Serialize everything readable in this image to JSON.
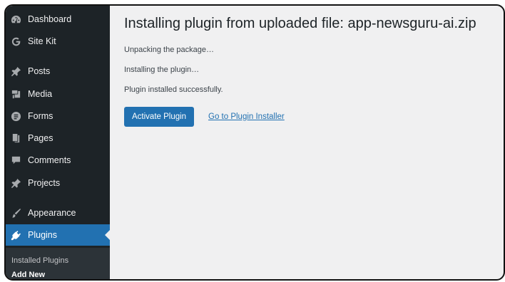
{
  "sidebar": {
    "items": [
      {
        "label": "Dashboard",
        "icon": "dashboard-icon"
      },
      {
        "label": "Site Kit",
        "icon": "google-g-icon"
      },
      {
        "label": "Posts",
        "icon": "pin-icon"
      },
      {
        "label": "Media",
        "icon": "media-icon"
      },
      {
        "label": "Forms",
        "icon": "forms-icon"
      },
      {
        "label": "Pages",
        "icon": "pages-icon"
      },
      {
        "label": "Comments",
        "icon": "comment-icon"
      },
      {
        "label": "Projects",
        "icon": "pin-icon"
      },
      {
        "label": "Appearance",
        "icon": "brush-icon"
      },
      {
        "label": "Plugins",
        "icon": "plug-icon",
        "active": true
      }
    ],
    "submenu": [
      {
        "label": "Installed Plugins"
      },
      {
        "label": "Add New",
        "current": true
      }
    ]
  },
  "main": {
    "title": "Installing plugin from uploaded file: app-newsguru-ai.zip",
    "messages": [
      "Unpacking the package…",
      "Installing the plugin…",
      "Plugin installed successfully."
    ],
    "activate_label": "Activate Plugin",
    "installer_link": "Go to Plugin Installer"
  },
  "colors": {
    "sidebar_bg": "#1d2327",
    "accent": "#2271b1",
    "content_bg": "#f0f0f1"
  }
}
